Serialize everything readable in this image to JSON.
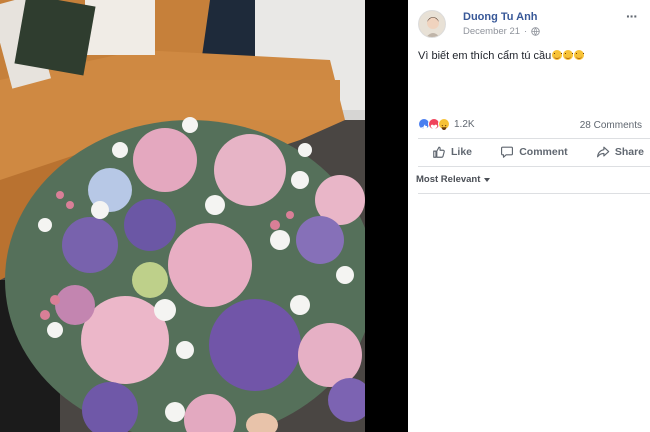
{
  "post": {
    "author": "Duong Tu Anh",
    "date": "December 21",
    "date_separator": "·",
    "caption": "Vì biết em thích cẩm tú cầu",
    "caption_emojis": [
      "smiling-face",
      "smiling-face",
      "smiling-face"
    ],
    "privacy_icon": "globe-icon",
    "more_icon": "more-options-icon"
  },
  "reactions": {
    "types": [
      "like",
      "love",
      "haha"
    ],
    "count": "1.2K",
    "comments": "28 Comments"
  },
  "actions": {
    "like": "Like",
    "comment": "Comment",
    "share": "Share"
  },
  "comments_filter": {
    "label": "Most Relevant"
  },
  "colors": {
    "author_link": "#385898",
    "secondary_text": "#90949c",
    "action_text": "#606770",
    "like_blue": "#4a7ff0",
    "love_red": "#f0425a",
    "haha_yellow": "#f7c236"
  }
}
